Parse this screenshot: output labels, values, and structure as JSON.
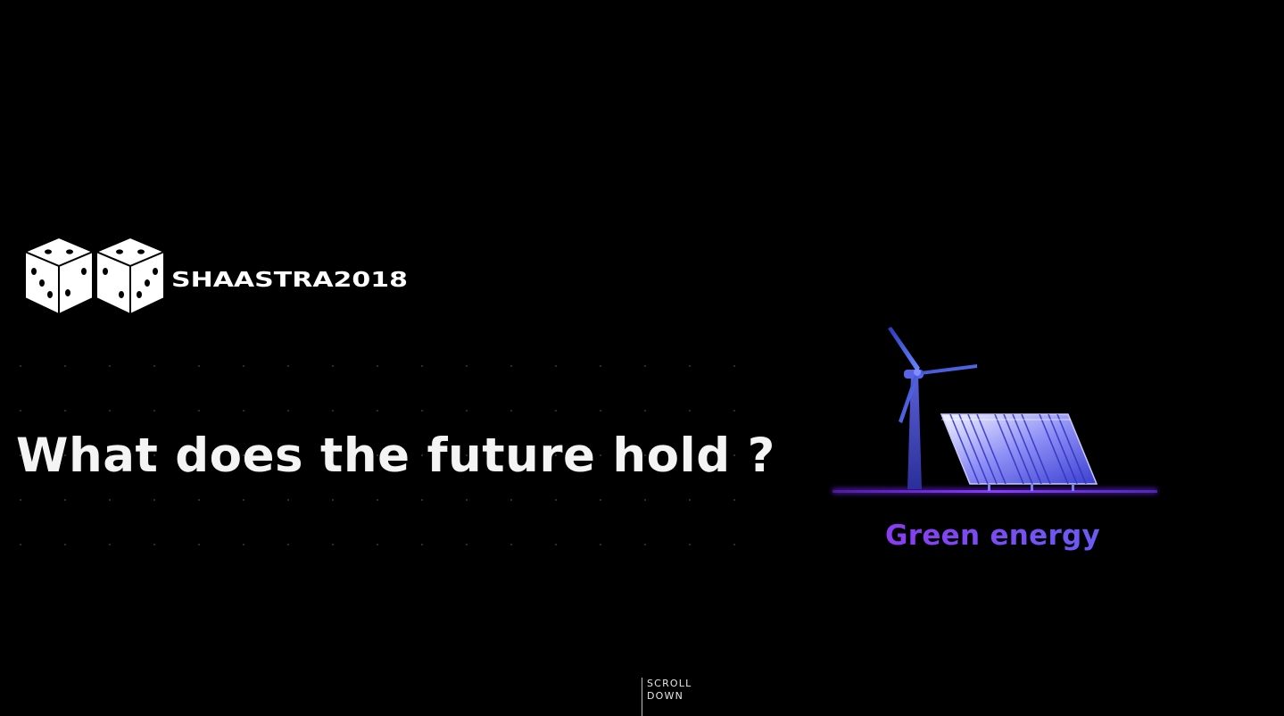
{
  "logo": {
    "text": "SHAASTRA2018",
    "icon": "dice-icon"
  },
  "hero": {
    "headline": "What does the future hold ?",
    "caption": "Green energy",
    "illustration": "wind-turbine-solar-panel-icon"
  },
  "scroll_hint": {
    "line1": "SCROLL",
    "line2": "DOWN"
  },
  "colors": {
    "background": "#000000",
    "text": "#f4f4f4",
    "accent": "#7d46f2",
    "accent_blue": "#5a6cf0"
  }
}
